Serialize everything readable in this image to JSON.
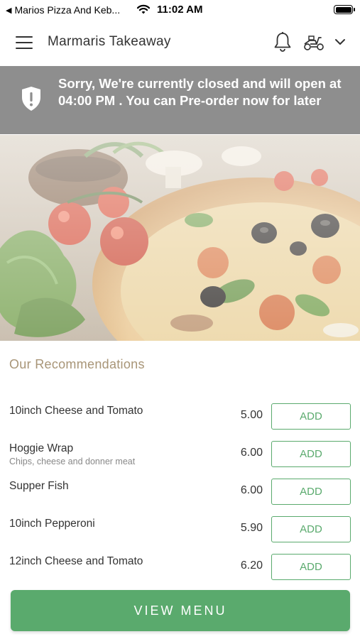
{
  "status_bar": {
    "back_app": "Marios Pizza And Keb...",
    "time": "11:02 AM"
  },
  "header": {
    "title": "Marmaris Takeaway",
    "icons": [
      "menu-icon",
      "bell-icon",
      "scooter-icon",
      "chevron-down-icon"
    ]
  },
  "banner": {
    "message": "Sorry, We're currently closed and will open at 04:00 PM . You can Pre-order now for later",
    "icon": "shield-alert-icon",
    "background": "#8e8e8e"
  },
  "recommendations": {
    "title": "Our Recommendations",
    "items": [
      {
        "name": "10inch Cheese and Tomato",
        "description": "",
        "price": "5.00",
        "button": "ADD"
      },
      {
        "name": "Hoggie Wrap",
        "description": "Chips, cheese and donner meat",
        "price": "6.00",
        "button": "ADD"
      },
      {
        "name": "Supper Fish",
        "description": "",
        "price": "6.00",
        "button": "ADD"
      },
      {
        "name": "10inch Pepperoni",
        "description": "",
        "price": "5.90",
        "button": "ADD"
      },
      {
        "name": "12inch Cheese and Tomato",
        "description": "",
        "price": "6.20",
        "button": "ADD"
      }
    ]
  },
  "footer": {
    "view_menu_label": "VIEW MENU"
  },
  "colors": {
    "accent": "#5aaa6d",
    "section_title": "#a89577",
    "banner": "#8e8e8e"
  }
}
